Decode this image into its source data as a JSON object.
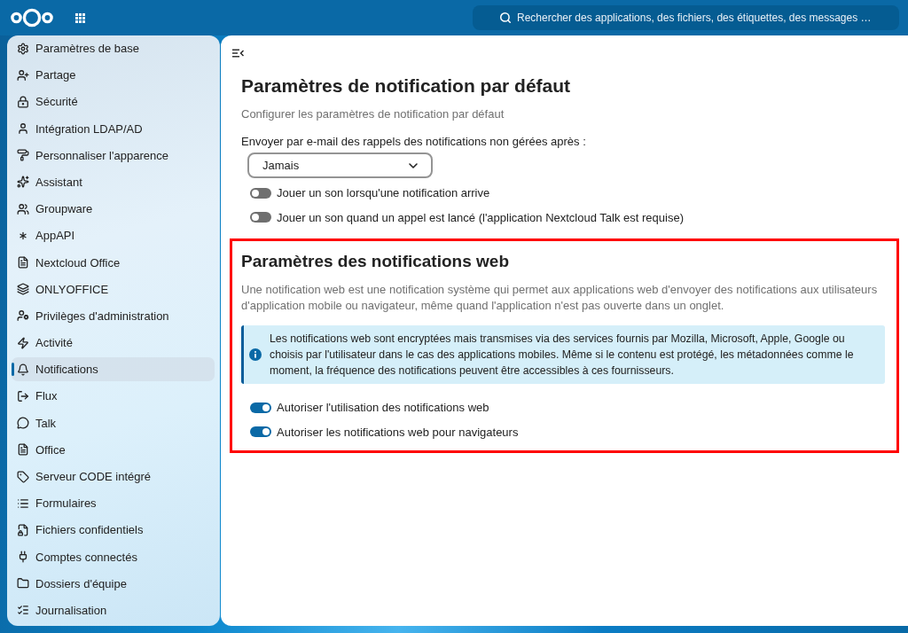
{
  "header": {
    "search": {
      "placeholder": "Rechercher des applications, des fichiers, des étiquettes, des messages …"
    }
  },
  "sidebar": {
    "items": [
      {
        "label": "Paramètres de base",
        "selected": false
      },
      {
        "label": "Partage",
        "selected": false
      },
      {
        "label": "Sécurité",
        "selected": false
      },
      {
        "label": "Intégration LDAP/AD",
        "selected": false
      },
      {
        "label": "Personnaliser l'apparence",
        "selected": false
      },
      {
        "label": "Assistant",
        "selected": false
      },
      {
        "label": "Groupware",
        "selected": false
      },
      {
        "label": "AppAPI",
        "selected": false
      },
      {
        "label": "Nextcloud Office",
        "selected": false
      },
      {
        "label": "ONLYOFFICE",
        "selected": false
      },
      {
        "label": "Privilèges d'administration",
        "selected": false
      },
      {
        "label": "Activité",
        "selected": false
      },
      {
        "label": "Notifications",
        "selected": true
      },
      {
        "label": "Flux",
        "selected": false
      },
      {
        "label": "Talk",
        "selected": false
      },
      {
        "label": "Office",
        "selected": false
      },
      {
        "label": "Serveur CODE intégré",
        "selected": false
      },
      {
        "label": "Formulaires",
        "selected": false
      },
      {
        "label": "Fichiers confidentiels",
        "selected": false
      },
      {
        "label": "Comptes connectés",
        "selected": false
      },
      {
        "label": "Dossiers d'équipe",
        "selected": false
      },
      {
        "label": "Journalisation",
        "selected": false
      }
    ]
  },
  "sections": [
    {
      "title": "Paramètres de notification par défaut",
      "highlighted": false,
      "description": "Configurer les paramètres de notification par défaut",
      "email_reminder": {
        "label": "Envoyer par e-mail des rappels des notifications non gérées après :",
        "value": "Jamais"
      },
      "toggles": [
        {
          "label": "Jouer un son lorsqu'une notification arrive",
          "on": false
        },
        {
          "label": "Jouer un son quand un appel est lancé (l'application Nextcloud Talk est requise)",
          "on": false
        }
      ]
    },
    {
      "title": "Paramètres des notifications web",
      "highlighted": true,
      "description": "Une notification web est une notification système qui permet aux applications web d'envoyer des notifications aux utilisateurs d'application mobile ou navigateur, même quand l'application n'est pas ouverte dans un onglet.",
      "info": "Les notifications web sont encryptées mais transmises via des services fournis par Mozilla, Microsoft, Apple, Google ou choisis par l'utilisateur dans le cas des applications mobiles. Même si le contenu est protégé, les métadonnées comme le moment, la fréquence des notifications peuvent être accessibles à ces fournisseurs.",
      "toggles": [
        {
          "label": "Autoriser l'utilisation des notifications web",
          "on": true
        },
        {
          "label": "Autoriser les notifications web pour navigateurs",
          "on": true
        }
      ]
    }
  ]
}
